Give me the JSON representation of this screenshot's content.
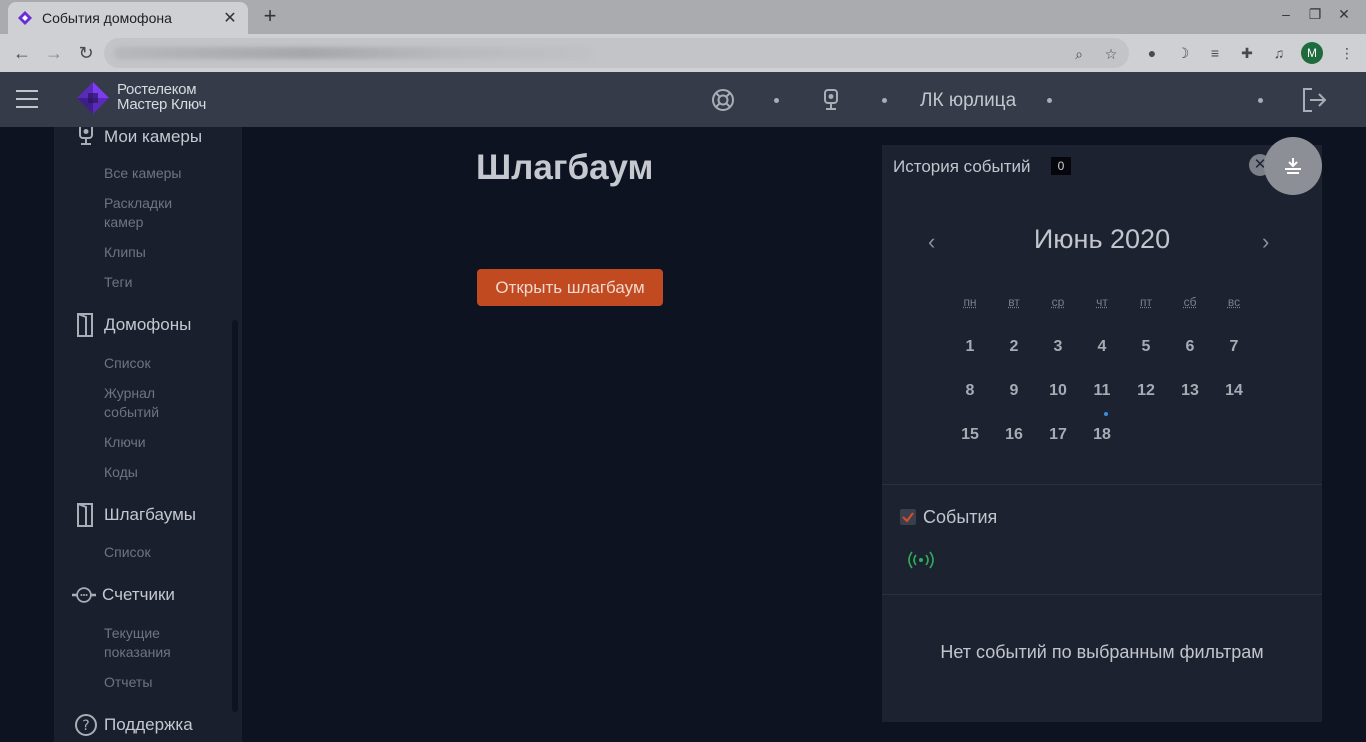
{
  "browser": {
    "tab_title": "События домофона",
    "tab_close": "✕",
    "new_tab": "+",
    "profile_initial": "M",
    "window_controls": [
      "–",
      "❐",
      "✕"
    ]
  },
  "header": {
    "logo_line1": "Ростелеком",
    "logo_line2": "Мастер Ключ",
    "link_label": "ЛК юрлица"
  },
  "sidebar": {
    "cameras": {
      "label": "Мои камеры",
      "items": [
        "Все камеры",
        "Раскладки камер",
        "Клипы",
        "Теги"
      ]
    },
    "intercoms": {
      "label": "Домофоны",
      "items": [
        "Список",
        "Журнал событий",
        "Ключи",
        "Коды"
      ]
    },
    "barriers": {
      "label": "Шлагбаумы",
      "items": [
        "Список"
      ]
    },
    "meters": {
      "label": "Счетчики",
      "items": [
        "Текущие показания",
        "Отчеты"
      ]
    },
    "support": {
      "label": "Поддержка"
    }
  },
  "main": {
    "title": "Шлагбаум",
    "open_button": "Открыть шлагбаум"
  },
  "history": {
    "title": "История событий",
    "count": "0",
    "close": "✕",
    "month": "Июнь 2020",
    "prev": "‹",
    "next": "›",
    "weekdays": [
      "пн",
      "вт",
      "ср",
      "чт",
      "пт",
      "сб",
      "вс"
    ],
    "days": [
      [
        "1",
        "2",
        "3",
        "4",
        "5",
        "6",
        "7"
      ],
      [
        "8",
        "9",
        "10",
        "11",
        "12",
        "13",
        "14"
      ],
      [
        "15",
        "16",
        "17",
        "18"
      ]
    ],
    "events_label": "События",
    "events_checked": true,
    "empty_text": "Нет событий по выбранным фильтрам"
  },
  "colors": {
    "accent_button": "#c24a20",
    "event_signal": "#2fae5b",
    "calendar_marker": "#3b8fd6"
  }
}
